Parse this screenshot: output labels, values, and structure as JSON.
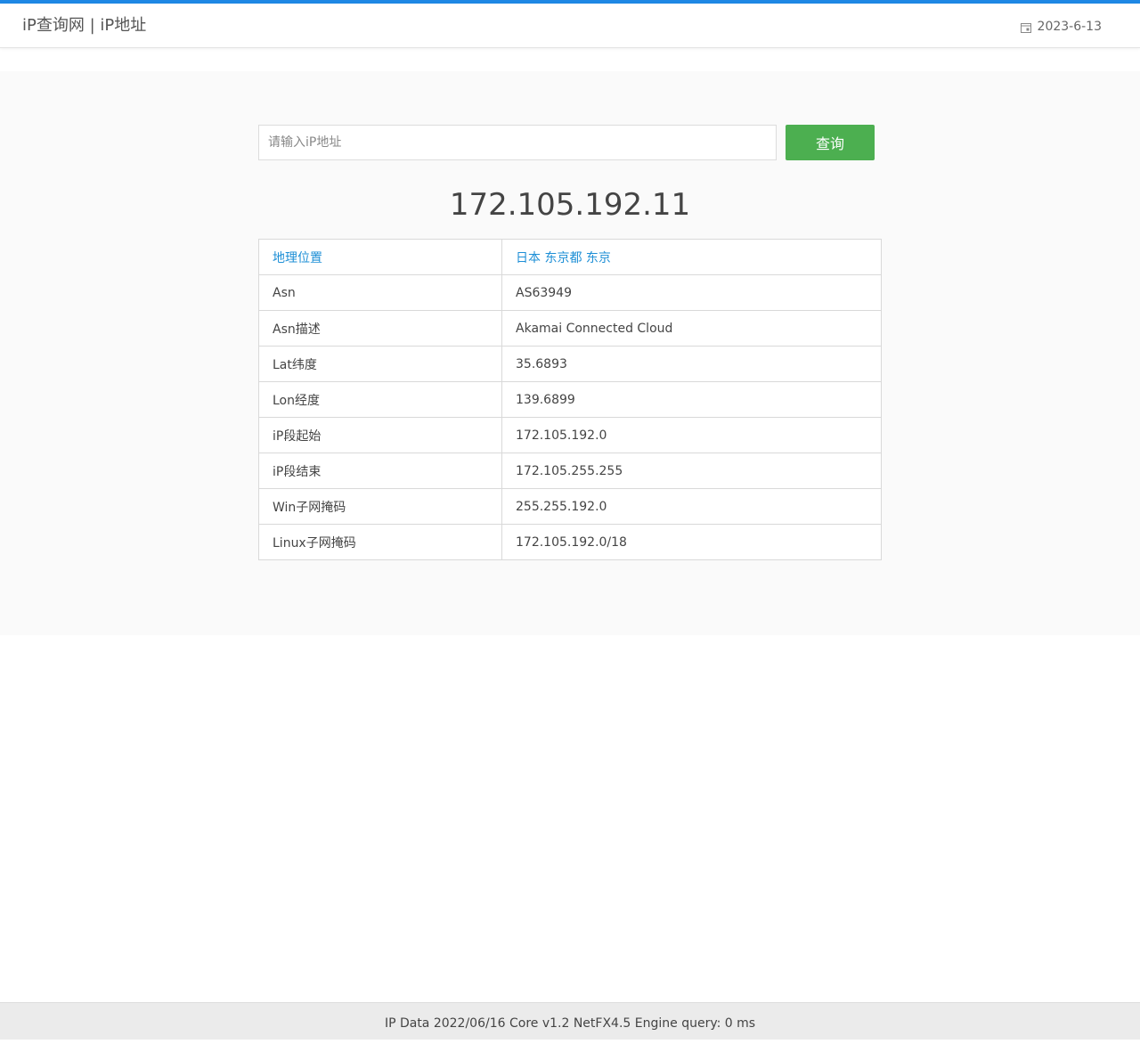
{
  "header": {
    "title": "iP查询网 | iP地址",
    "date": "2023-6-13",
    "date_icon": "calendar-icon"
  },
  "search": {
    "placeholder": "请输入iP地址",
    "value": "",
    "button_label": "查询"
  },
  "result": {
    "ip": "172.105.192.11",
    "rows": [
      {
        "label": "地理位置",
        "value": "日本 东京都 东京"
      },
      {
        "label": "Asn",
        "value": "AS63949"
      },
      {
        "label": "Asn描述",
        "value": "Akamai Connected Cloud"
      },
      {
        "label": "Lat纬度",
        "value": "35.6893"
      },
      {
        "label": "Lon经度",
        "value": "139.6899"
      },
      {
        "label": "iP段起始",
        "value": "172.105.192.0"
      },
      {
        "label": "iP段结束",
        "value": "172.105.255.255"
      },
      {
        "label": "Win子网掩码",
        "value": "255.255.192.0"
      },
      {
        "label": "Linux子网掩码",
        "value": "172.105.192.0/18"
      }
    ]
  },
  "footer": {
    "text": "IP Data 2022/06/16 Core v1.2 NetFX4.5 Engine query: 0 ms"
  },
  "colors": {
    "accent": "#1e88e5",
    "button": "#4caf50",
    "link": "#1e8fd6"
  }
}
